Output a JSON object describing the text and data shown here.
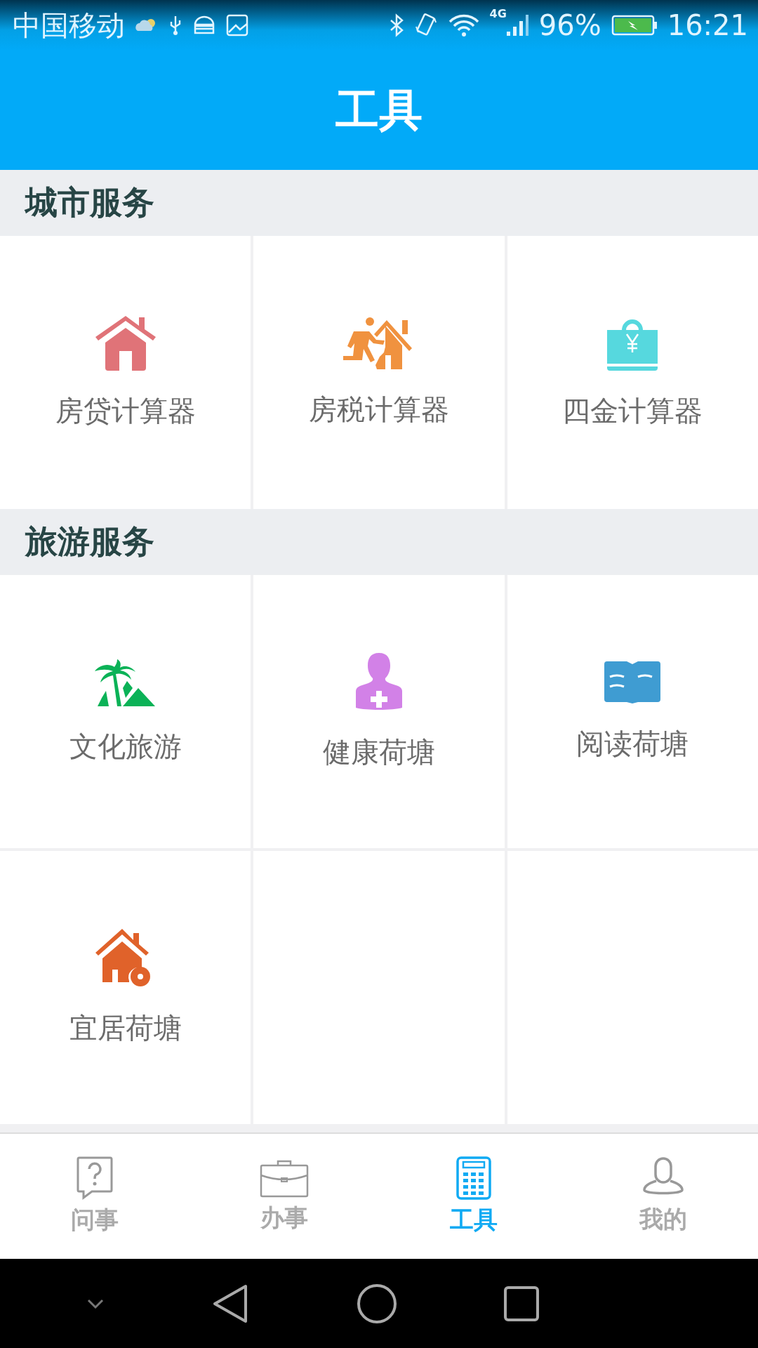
{
  "status_bar": {
    "carrier": "中国移动",
    "network": "4G",
    "battery": "96%",
    "time": "16:21"
  },
  "title": "工具",
  "sections": [
    {
      "title": "城市服务",
      "items": [
        {
          "label": "房贷计算器",
          "kind": "house"
        },
        {
          "label": "房税计算器",
          "kind": "runner-house"
        },
        {
          "label": "四金计算器",
          "kind": "bag"
        }
      ]
    },
    {
      "title": "旅游服务",
      "items": [
        {
          "label": "文化旅游",
          "kind": "palm"
        },
        {
          "label": "健康荷塘",
          "kind": "person"
        },
        {
          "label": "阅读荷塘",
          "kind": "book"
        },
        {
          "label": "宜居荷塘",
          "kind": "house-key"
        }
      ]
    }
  ],
  "tabs": [
    {
      "label": "问事",
      "kind": "question",
      "selected": false
    },
    {
      "label": "办事",
      "kind": "briefcase",
      "selected": false
    },
    {
      "label": "工具",
      "kind": "calculator",
      "selected": true
    },
    {
      "label": "我的",
      "kind": "user",
      "selected": false
    }
  ]
}
